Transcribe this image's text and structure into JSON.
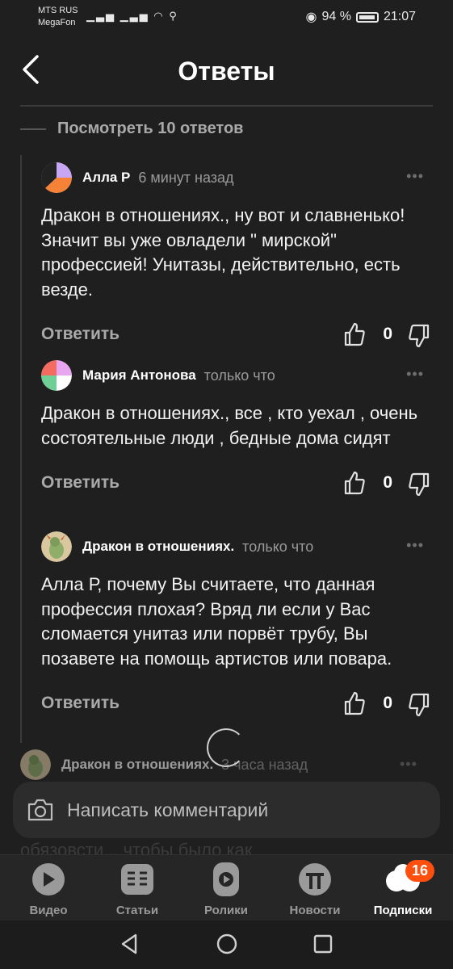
{
  "status_bar": {
    "carrier_1": "MTS RUS",
    "carrier_2": "MegaFon",
    "battery": "94 %",
    "time": "21:07"
  },
  "header": {
    "title": "Ответы"
  },
  "thread": {
    "view_replies": "Посмотреть 10 ответов"
  },
  "comments": [
    {
      "author": "Алла Р",
      "time": "6 минут назад",
      "text": "Дракон в отношениях., ну вот и славненько! Значит вы уже овладели \" мирской\" профессией! Унитазы, действительно, есть везде.",
      "reply": "Ответить",
      "likes": "0",
      "avatar_colors": [
        "#f58236",
        "#c7a6f4",
        "#ffffff",
        "#222222"
      ]
    },
    {
      "author": "Мария Антонова",
      "time": "только что",
      "text": "Дракон в отношениях., все , кто уехал , очень состоятельные люди , бедные дома сидят",
      "reply": "Ответить",
      "likes": "0",
      "avatar_colors": [
        "#f46b5f",
        "#6fcf97",
        "#e9a6f0",
        "#ffffff"
      ]
    },
    {
      "author": "Дракон в отношениях.",
      "time": "только что",
      "text": "Алла Р, почему Вы считаете, что данная профессия плохая? Вряд ли если у Вас сломается унитаз или порвёт трубу, Вы позавете на помощь артистов или повара.",
      "reply": "Ответить",
      "likes": "0",
      "avatar_colors": [
        "#8fae6a",
        "#d9c7a0"
      ]
    }
  ],
  "peek_comment": {
    "author": "Дракон в отношениях.",
    "time": "3 часа назад"
  },
  "composer": {
    "placeholder": "Написать комментарий",
    "ghost_text": "обязовсти... чтобы было как"
  },
  "tabs": [
    {
      "label": "Видео",
      "icon": "video-icon"
    },
    {
      "label": "Статьи",
      "icon": "articles-icon"
    },
    {
      "label": "Ролики",
      "icon": "shorts-icon"
    },
    {
      "label": "Новости",
      "icon": "news-icon"
    },
    {
      "label": "Подписки",
      "icon": "subscriptions-icon",
      "badge": "16",
      "active": true
    }
  ],
  "colors": {
    "background": "#1f1f1f",
    "accent": "#ff4f0f",
    "muted": "#a9a9a9"
  }
}
